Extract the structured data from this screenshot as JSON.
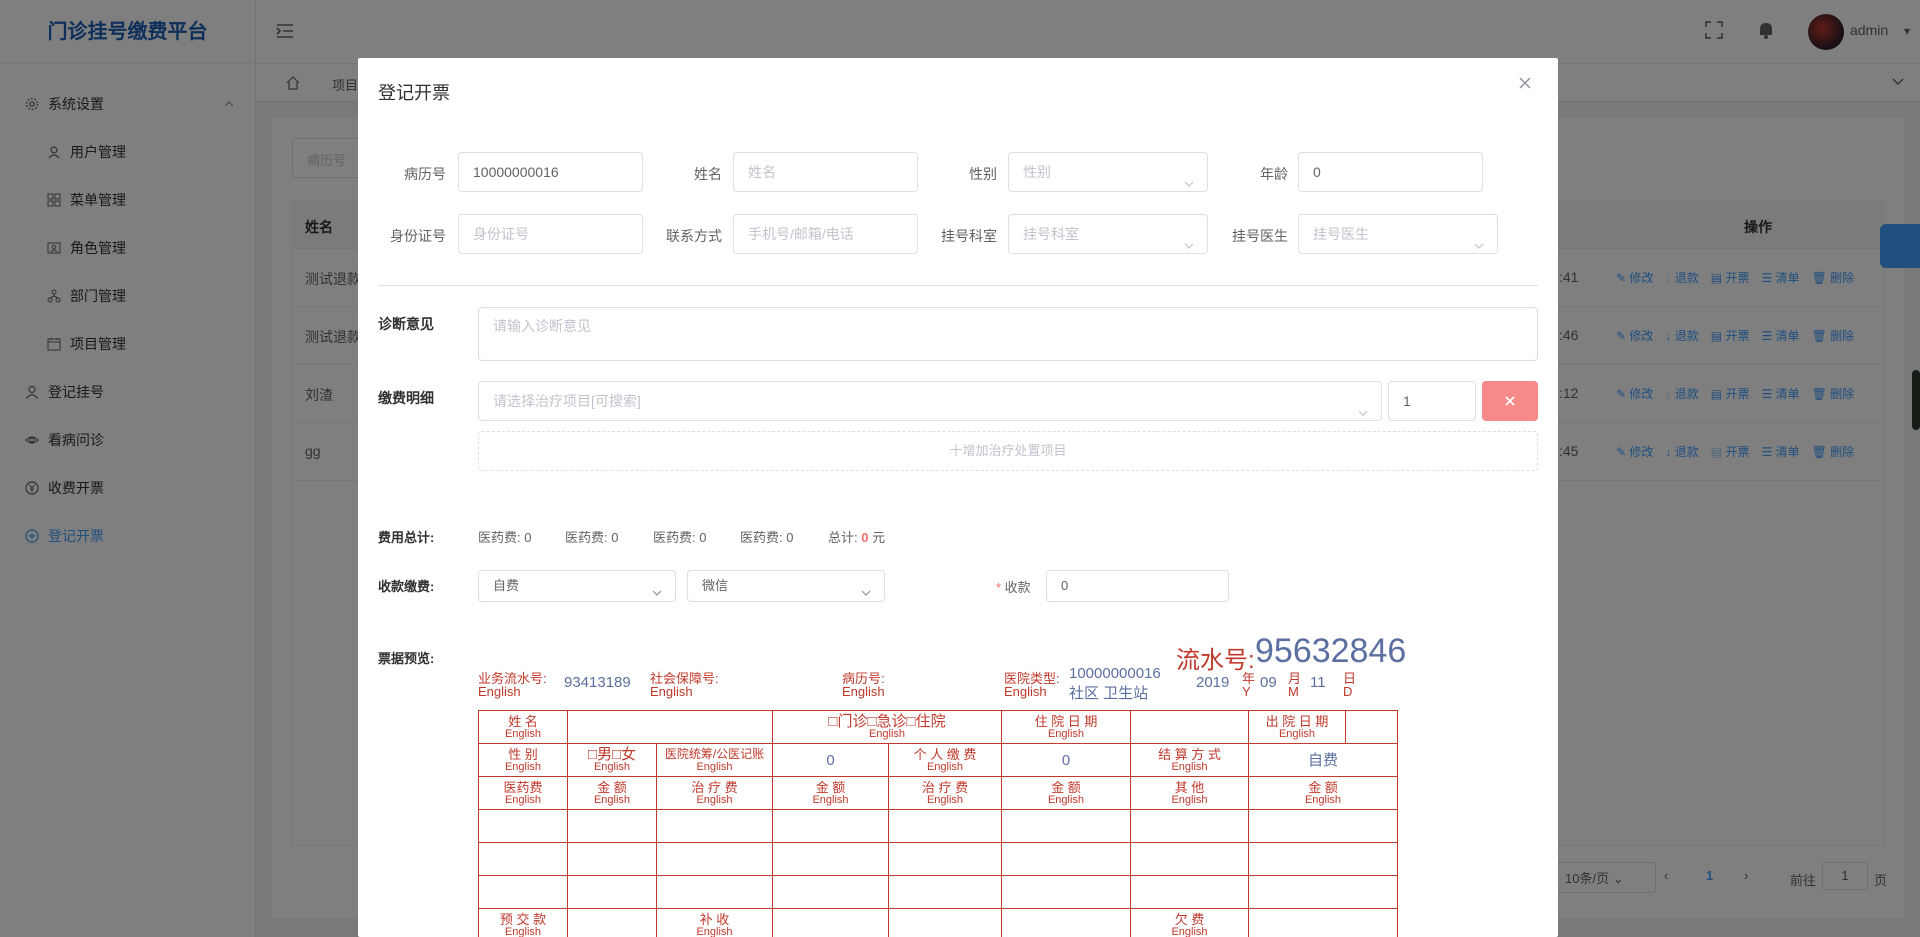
{
  "app": {
    "title": "门诊挂号缴费平台"
  },
  "sidebar": {
    "group": "系统设置",
    "sub_items": [
      {
        "label": "用户管理"
      },
      {
        "label": "菜单管理"
      },
      {
        "label": "角色管理"
      },
      {
        "label": "部门管理"
      },
      {
        "label": "项目管理"
      }
    ],
    "items": [
      {
        "label": "登记挂号"
      },
      {
        "label": "看病问诊"
      },
      {
        "label": "收费开票"
      },
      {
        "label": "登记开票"
      }
    ]
  },
  "header": {
    "user": "admin"
  },
  "tabs": {
    "first": "项目"
  },
  "background_table": {
    "search_placeholder": "病历号",
    "col_name": "姓名",
    "col_ops": "操作",
    "rows": [
      {
        "name": "测试退款",
        "time": ":41",
        "ops": [
          "修改",
          "退款",
          "开票",
          "清单",
          "删除"
        ]
      },
      {
        "name": "测试退款",
        "time": ":46",
        "ops": [
          "修改",
          "退款",
          "开票",
          "清单",
          "删除"
        ]
      },
      {
        "name": "刘渣",
        "time": ":12",
        "ops": [
          "修改",
          "退款",
          "开票",
          "清单",
          "删除"
        ]
      },
      {
        "name": "gg",
        "time": ":45",
        "ops": [
          "修改",
          "退款",
          "开票",
          "清单",
          "删除"
        ]
      }
    ],
    "page_size": "10条/页",
    "page": "1",
    "goto_label": "前往",
    "goto_value": "1",
    "goto_unit": "页"
  },
  "dialog": {
    "title": "登记开票",
    "form": {
      "record_no_label": "病历号",
      "record_no_value": "10000000016",
      "name_label": "姓名",
      "name_placeholder": "姓名",
      "gender_label": "性别",
      "gender_placeholder": "性别",
      "age_label": "年龄",
      "age_value": "0",
      "id_label": "身份证号",
      "id_placeholder": "身份证号",
      "contact_label": "联系方式",
      "contact_placeholder": "手机号/邮箱/电话",
      "dept_label": "挂号科室",
      "dept_placeholder": "挂号科室",
      "doctor_label": "挂号医生",
      "doctor_placeholder": "挂号医生",
      "diagnosis_label": "诊断意见",
      "diagnosis_placeholder": "请输入诊断意见",
      "detail_label": "缴费明细",
      "detail_placeholder": "请选择治疗项目[可搜索]",
      "detail_qty": "1",
      "add_item": "十增加治疗处置项目",
      "total_label": "费用总计:",
      "fees": [
        "医药费: 0",
        "医药费: 0",
        "医药费: 0",
        "医药费: 0"
      ],
      "total_prefix": "总计:",
      "total_value": "0",
      "total_unit": "元",
      "pay_label": "收款缴费:",
      "pay_type": "自费",
      "pay_method": "微信",
      "receive_label": "收款",
      "receive_value": "0",
      "preview_label": "票据预览:"
    },
    "receipt": {
      "serial_title": "流水号:",
      "serial_value": "95632846",
      "biz_no_label": "业务流水号:",
      "biz_no_value": "93413189",
      "social_label": "社会保障号:",
      "record_label": "病历号:",
      "hospital_type_label": "医院类型:",
      "hospital_type_value1": "10000000016",
      "hospital_type_value2": "社区 卫生站",
      "english": "English",
      "year": "2019",
      "year_cn": "年",
      "year_en": "Y",
      "month": "09",
      "month_cn": "月",
      "month_en": "M",
      "day": "11",
      "day_cn": "日",
      "day_en": "D",
      "name_cell": "姓 名",
      "visit_type": "□门诊□急诊□住院",
      "admit_date": "住 院 日 期",
      "discharge_date": "出 院 日 期",
      "gender_cell": "性 别",
      "gender_choice": "□男□女",
      "pooling": "医院统筹/公医记账",
      "pooling_value": "0",
      "personal_pay": "个 人 缴 费",
      "personal_value": "0",
      "settle": "结 算 方 式",
      "settle_value": "自费",
      "drug_fee": "医药费",
      "amount": "金 额",
      "treat_fee": "治 疗 费",
      "other": "其 他",
      "prepay": "预 交 款",
      "supplement": "补 收",
      "owed": "欠 费"
    }
  }
}
